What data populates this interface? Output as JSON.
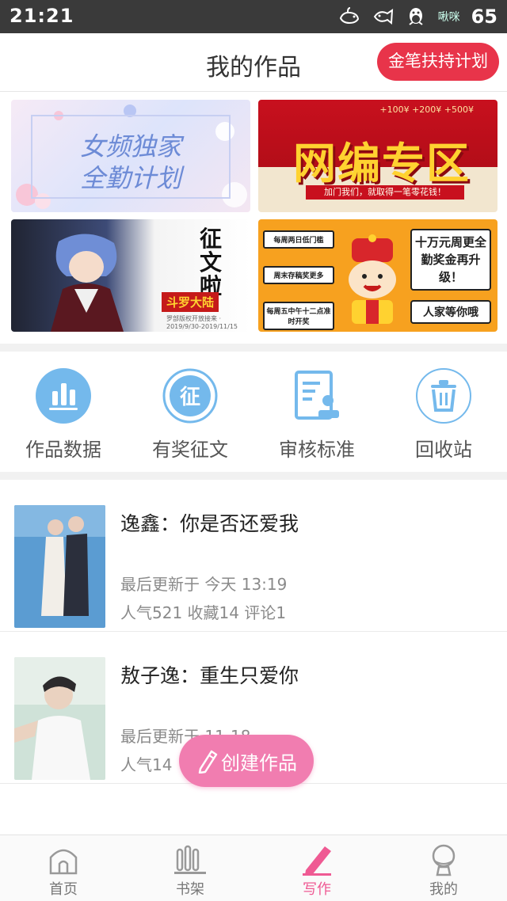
{
  "status_bar": {
    "time": "21:21",
    "carrier": "啾咪",
    "battery": "65",
    "icons": [
      "whale-notification-icon",
      "fish-notification-icon",
      "qq-penguin-icon"
    ]
  },
  "header": {
    "title": "我的作品",
    "plan_button": "金笔扶持计划",
    "accent_color": "#e8344a"
  },
  "banners": [
    {
      "id": "female-exclusive",
      "line1": "女频独家",
      "line2": "全勤计划"
    },
    {
      "id": "web-zone",
      "headline": "网编专区",
      "amounts": "+100¥  +200¥  +500¥",
      "subtitle": "加门我们，就取得一笔零花钱！"
    },
    {
      "id": "essay-contest",
      "headline": "征文啦",
      "tag": "斗罗大陆",
      "dates": "罗部版权开放接来 · 2019/9/30-2019/11/15"
    },
    {
      "id": "weekly-bonus",
      "chips": [
        "每周两日低门槛",
        "周末存稿奖更多",
        "每周五中午十二点准时开奖"
      ],
      "bubble": "十万元周更全勤奖金再升级！",
      "bubble2": "人家等你哦"
    }
  ],
  "quick_menu": [
    {
      "label": "作品数据",
      "icon": "bar-chart-icon"
    },
    {
      "label": "有奖征文",
      "icon": "contest-seal-icon"
    },
    {
      "label": "审核标准",
      "icon": "review-document-icon"
    },
    {
      "label": "回收站",
      "icon": "trash-icon"
    }
  ],
  "works": [
    {
      "title": "逸鑫：你是否还爱我",
      "updated": "最后更新于 今天 13:19",
      "stats": "人气521 收藏14 评论1"
    },
    {
      "title": "敖子逸：重生只爱你",
      "updated": "最后更新于 11-18",
      "stats": "人气14"
    }
  ],
  "create_button": {
    "label": "创建作品",
    "color": "#f17db0"
  },
  "bottom_nav": [
    {
      "label": "首页",
      "icon": "home-icon",
      "active": false
    },
    {
      "label": "书架",
      "icon": "bookshelf-icon",
      "active": false
    },
    {
      "label": "写作",
      "icon": "pencil-icon",
      "active": true
    },
    {
      "label": "我的",
      "icon": "profile-icon",
      "active": false
    }
  ],
  "colors": {
    "active_pink": "#ef5a93",
    "icon_blue": "#6fb6ea"
  }
}
